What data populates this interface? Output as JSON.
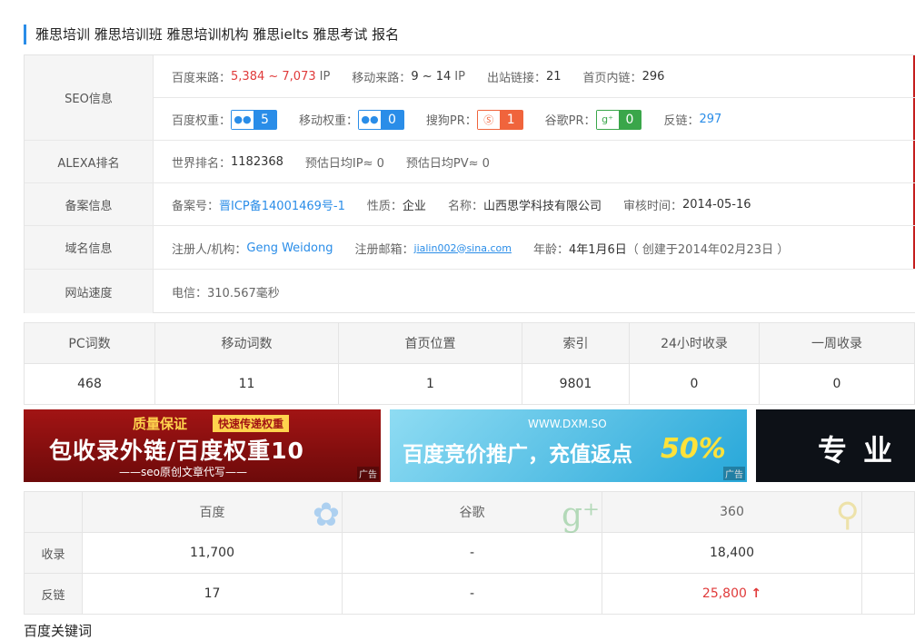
{
  "title": "雅思培训 雅思培训班 雅思培训机构 雅思ielts 雅思考试 报名",
  "seo": {
    "label": "SEO信息",
    "baidu_traffic_label": "百度来路：",
    "baidu_traffic_value": "5,384 ~ 7,073",
    "ip_unit": "IP",
    "mobile_traffic_label": "移动来路：",
    "mobile_traffic_value": "9 ~ 14",
    "outbound_label": "出站链接：",
    "outbound_value": "21",
    "inner_label": "首页内链：",
    "inner_value": "296",
    "baidu_weight_label": "百度权重：",
    "baidu_weight_value": "5",
    "mobile_weight_label": "移动权重：",
    "mobile_weight_value": "0",
    "sogou_label": "搜狗PR：",
    "sogou_value": "1",
    "google_label": "谷歌PR：",
    "google_value": "0",
    "backlink_label": "反链：",
    "backlink_value": "297"
  },
  "alexa": {
    "label": "ALEXA排名",
    "world_label": "世界排名：",
    "world_value": "1182368",
    "ip_est": "预估日均IP≈ 0",
    "pv_est": "预估日均PV≈ 0"
  },
  "icp": {
    "label": "备案信息",
    "no_label": "备案号：",
    "no_value": "晋ICP备14001469号-1",
    "type_label": "性质：",
    "type_value": "企业",
    "name_label": "名称：",
    "name_value": "山西思学科技有限公司",
    "date_label": "审核时间：",
    "date_value": "2014-05-16"
  },
  "domain": {
    "label": "域名信息",
    "registrant_label": "注册人/机构：",
    "registrant_value": "Geng Weidong",
    "email_label": "注册邮箱：",
    "email_value": "jialin002@sina.com",
    "age_label": "年龄：",
    "age_value": "4年1月6日",
    "created": "（ 创建于2014年02月23日 ）"
  },
  "speed": {
    "label": "网站速度",
    "value": "电信：310.567毫秒"
  },
  "stats": {
    "headers": [
      "PC词数",
      "移动词数",
      "首页位置",
      "索引",
      "24小时收录",
      "一周收录"
    ],
    "values": [
      "468",
      "11",
      "1",
      "9801",
      "0",
      "0"
    ]
  },
  "ads": {
    "tag": "广告",
    "ad1_line1": "质量保证",
    "ad1_badge": "快速传递权重",
    "ad1_line2": "包收录外链/百度权重10",
    "ad1_line3": "——seo原创文章代写——",
    "ad2_line1": "WWW.DXM.SO",
    "ad2_line2": "百度竞价推广，充值返点",
    "ad2_line3": "50%",
    "ad3_line1": "专业"
  },
  "engines": {
    "headers": [
      "百度",
      "谷歌",
      "360"
    ],
    "row1_label": "收录",
    "row1": [
      "11,700",
      "-",
      "18,400"
    ],
    "row2_label": "反链",
    "row2": [
      "17",
      "-",
      "25,800"
    ],
    "up_arrow": "↑"
  },
  "bottom_title": "百度关键词"
}
